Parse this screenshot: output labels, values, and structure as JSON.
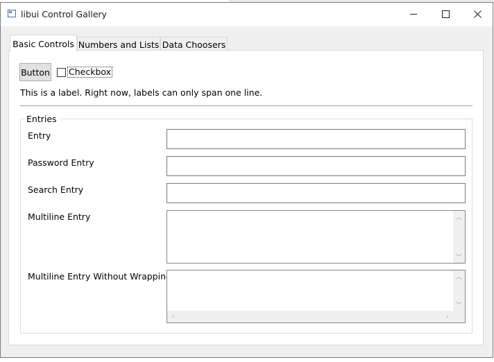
{
  "window": {
    "title": "libui Control Gallery"
  },
  "tabs": [
    {
      "label": "Basic Controls",
      "active": true
    },
    {
      "label": "Numbers and Lists",
      "active": false
    },
    {
      "label": "Data Choosers",
      "active": false
    }
  ],
  "basic": {
    "button_label": "Button",
    "checkbox_label": "Checkbox",
    "checkbox_checked": false,
    "label_text": "This is a label. Right now, labels can only span one line."
  },
  "entries": {
    "group_title": "Entries",
    "entry_label": "Entry",
    "entry_value": "",
    "password_label": "Password Entry",
    "password_value": "",
    "search_label": "Search Entry",
    "search_value": "",
    "multiline_label": "Multiline Entry",
    "multiline_value": "",
    "multiline_nowrap_label": "Multiline Entry Without Wrapping",
    "multiline_nowrap_value": ""
  }
}
